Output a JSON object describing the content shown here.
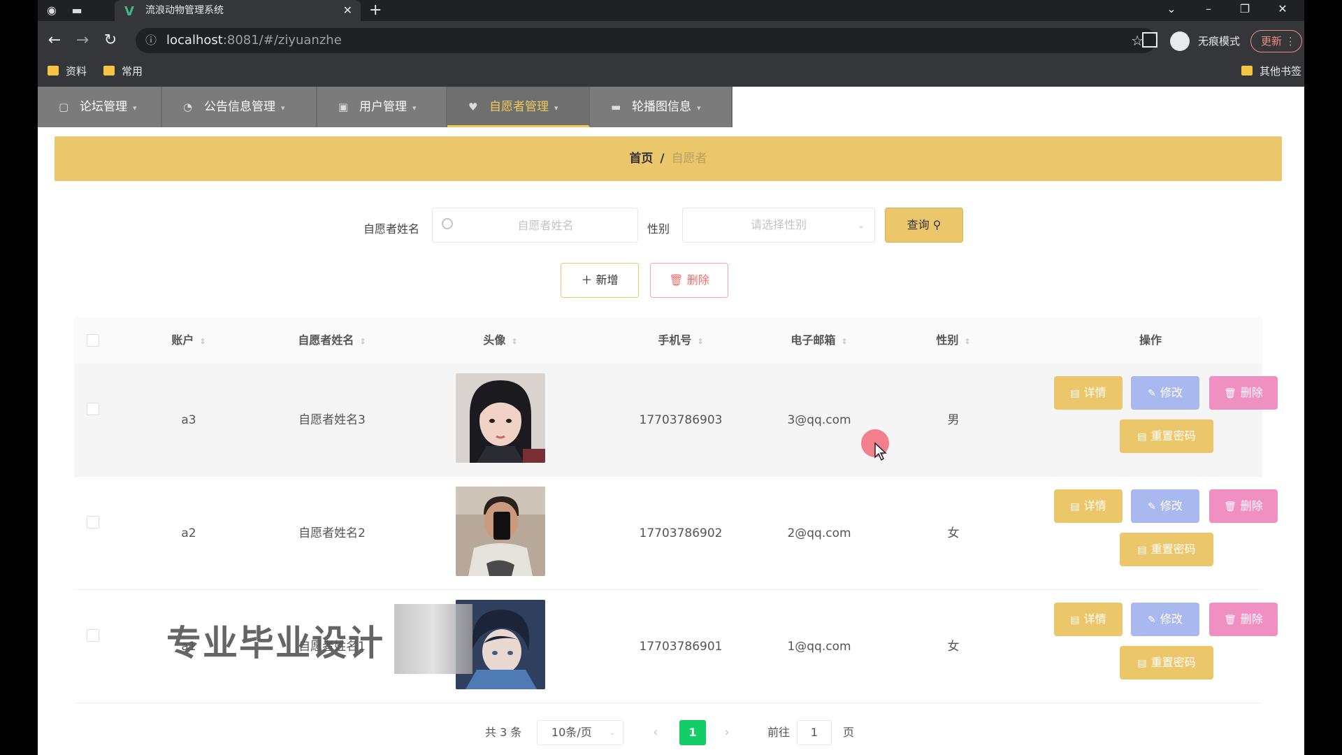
{
  "browser": {
    "tab_title": "流浪动物管理系统",
    "url_host": "localhost",
    "url_path": ":8081/#/ziyuanzhe",
    "incognito_label": "无痕模式",
    "update_label": "更新",
    "bookmarks": [
      "资料",
      "常用"
    ],
    "other_bookmarks": "其他书签"
  },
  "nav": {
    "items": [
      {
        "label": "论坛管理",
        "icon": "forum-icon"
      },
      {
        "label": "公告信息管理",
        "icon": "notice-icon"
      },
      {
        "label": "用户管理",
        "icon": "user-icon"
      },
      {
        "label": "自愿者管理",
        "icon": "volunteer-icon",
        "active": true
      },
      {
        "label": "轮播图信息",
        "icon": "carousel-icon"
      }
    ]
  },
  "breadcrumb": {
    "home": "首页",
    "separator": "/",
    "current": "自愿者"
  },
  "search": {
    "name_label": "自愿者姓名",
    "name_placeholder": "自愿者姓名",
    "sex_label": "性别",
    "sex_placeholder": "请选择性别",
    "query_label": "查询"
  },
  "actions": {
    "add_label": "新增",
    "delete_label": "删除"
  },
  "table": {
    "headers": [
      "账户",
      "自愿者姓名",
      "头像",
      "手机号",
      "电子邮箱",
      "性别",
      "操作"
    ],
    "rows": [
      {
        "account": "a3",
        "name": "自愿者姓名3",
        "phone": "17703786903",
        "email": "3@qq.com",
        "sex": "男"
      },
      {
        "account": "a2",
        "name": "自愿者姓名2",
        "phone": "17703786902",
        "email": "2@qq.com",
        "sex": "女"
      },
      {
        "account": "a1",
        "name": "自愿者姓名1",
        "phone": "17703786901",
        "email": "1@qq.com",
        "sex": "女"
      }
    ],
    "row_actions": {
      "detail": "详情",
      "edit": "修改",
      "delete": "删除",
      "reset": "重置密码"
    }
  },
  "pagination": {
    "total": "共 3 条",
    "page_size": "10条/页",
    "current_page": "1",
    "goto_label": "前往",
    "goto_value": "1",
    "page_unit": "页"
  },
  "overlay": {
    "watermark": "专业毕业设计"
  },
  "colors": {
    "accent": "#ecc66a",
    "edit": "#a9b8ee",
    "danger": "#f08fc2",
    "pager_active": "#13ce66"
  }
}
